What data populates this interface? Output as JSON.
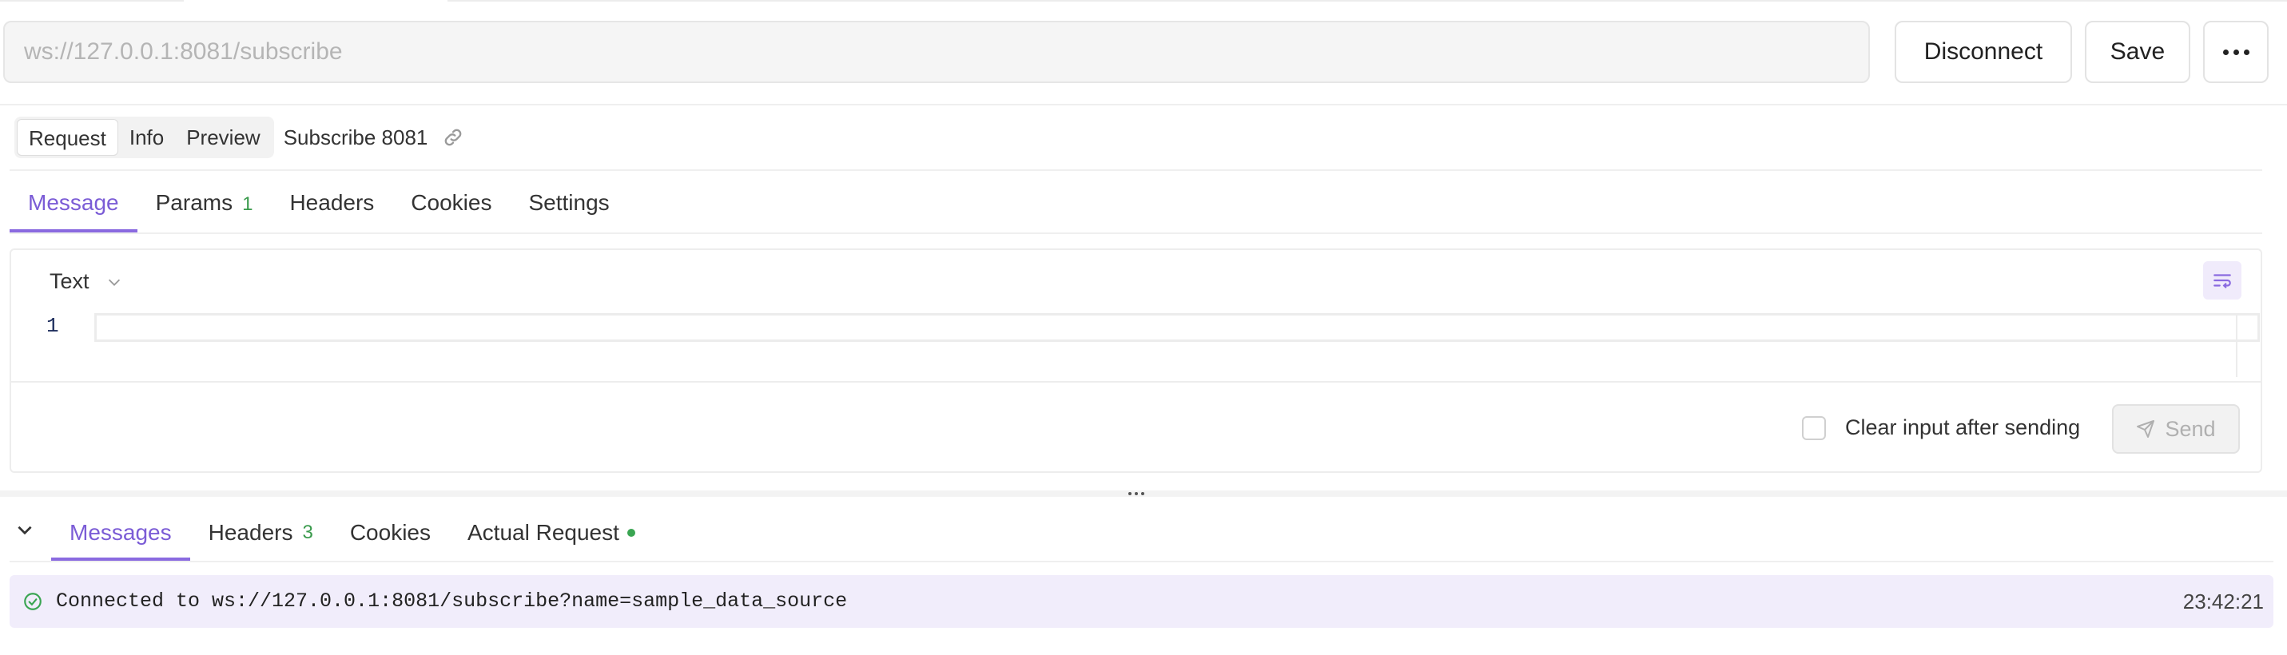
{
  "url_bar": {
    "value": "",
    "placeholder": "ws://127.0.0.1:8081/subscribe"
  },
  "actions": {
    "disconnect_label": "Disconnect",
    "save_label": "Save",
    "more_icon": "more-horizontal-icon"
  },
  "mode_tabs": [
    {
      "label": "Request",
      "active": true
    },
    {
      "label": "Info",
      "active": false
    },
    {
      "label": "Preview",
      "active": false
    }
  ],
  "request_name": "Subscribe 8081",
  "request_tabs": [
    {
      "label": "Message",
      "active": true
    },
    {
      "label": "Params",
      "badge": "1"
    },
    {
      "label": "Headers"
    },
    {
      "label": "Cookies"
    },
    {
      "label": "Settings"
    }
  ],
  "editor": {
    "format_label": "Text",
    "line_numbers": [
      "1"
    ],
    "content": "",
    "wrap_icon": "word-wrap-icon"
  },
  "send_area": {
    "clear_label": "Clear input after sending",
    "clear_checked": false,
    "send_label": "Send",
    "send_icon": "send-icon"
  },
  "response_tabs": [
    {
      "label": "Messages",
      "active": true
    },
    {
      "label": "Headers",
      "badge": "3"
    },
    {
      "label": "Cookies"
    },
    {
      "label": "Actual Request",
      "status_dot": true
    }
  ],
  "messages": [
    {
      "status_icon": "check-circle-icon",
      "text": "Connected to ws://127.0.0.1:8081/subscribe?name=sample_data_source",
      "time": "23:42:21"
    }
  ],
  "colors": {
    "accent": "#7b5cd6",
    "badge_green": "#3a9a4c",
    "message_bg": "#f1edfb",
    "status_green": "#3aa552"
  }
}
